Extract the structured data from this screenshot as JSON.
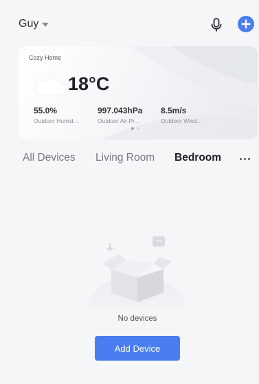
{
  "header": {
    "home_name": "Guy",
    "icons": {
      "mic": "microphone-icon",
      "add": "plus-circle-icon"
    },
    "accent_color": "#4a7ef0"
  },
  "weather": {
    "home_label": "Cozy Home",
    "temperature": "18°C",
    "condition_icon": "cloud-icon",
    "metrics": [
      {
        "value": "55.0%",
        "label": "Outdoor Humid..."
      },
      {
        "value": "997.043hPa",
        "label": "Outdoor Air Pr..."
      },
      {
        "value": "8.5m/s",
        "label": "Outdoor Wind..."
      }
    ],
    "pager": {
      "count": 2,
      "active": 1
    }
  },
  "tabs": [
    {
      "label": "All Devices",
      "active": false
    },
    {
      "label": "Living Room",
      "active": false
    },
    {
      "label": "Bedroom",
      "active": true
    }
  ],
  "empty_state": {
    "message": "No devices",
    "button_label": "Add Device"
  }
}
